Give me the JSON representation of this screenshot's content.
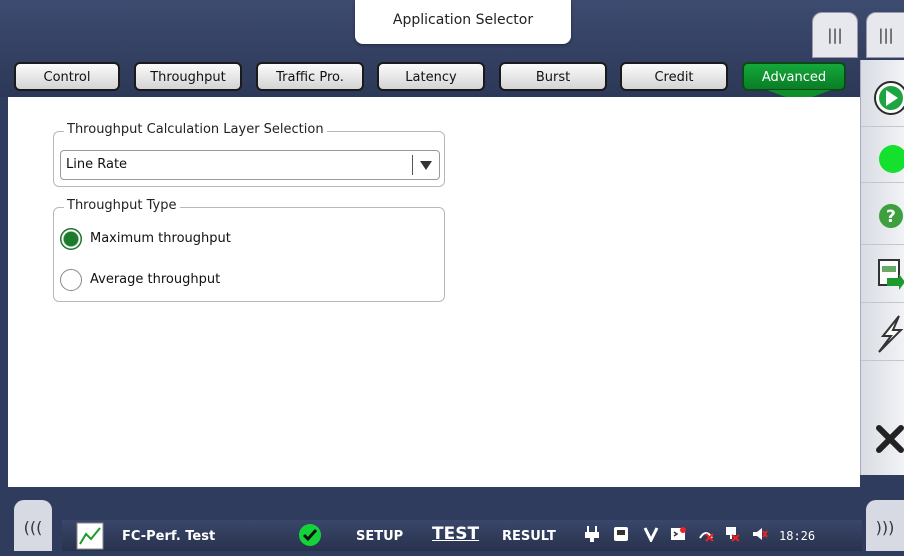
{
  "header": {
    "app_selector_label": "Application Selector",
    "handle_glyph": "|||"
  },
  "tabs": [
    "Control",
    "Throughput",
    "Traffic Pro.",
    "Latency",
    "Burst",
    "Credit",
    "Advanced"
  ],
  "active_tab": "Advanced",
  "layer_group": {
    "title": "Throughput Calculation Layer Selection",
    "selected": "Line Rate"
  },
  "type_group": {
    "title": "Throughput Type",
    "options": [
      "Maximum throughput",
      "Average throughput"
    ],
    "selected": "Maximum throughput"
  },
  "side_buttons": [
    "play-icon",
    "status-led-icon",
    "help-icon",
    "report-icon",
    "lightning-icon",
    "close-icon"
  ],
  "status_bar": {
    "left_handle": "(((",
    "right_handle": ")))",
    "app_name": "FC-Perf. Test",
    "setup_label": "SETUP",
    "test_label": "TEST",
    "result_label": "RESULT",
    "time": "18:26"
  },
  "colors": {
    "accent_green": "#12a235",
    "bar_blue": "#2f3c5d"
  }
}
